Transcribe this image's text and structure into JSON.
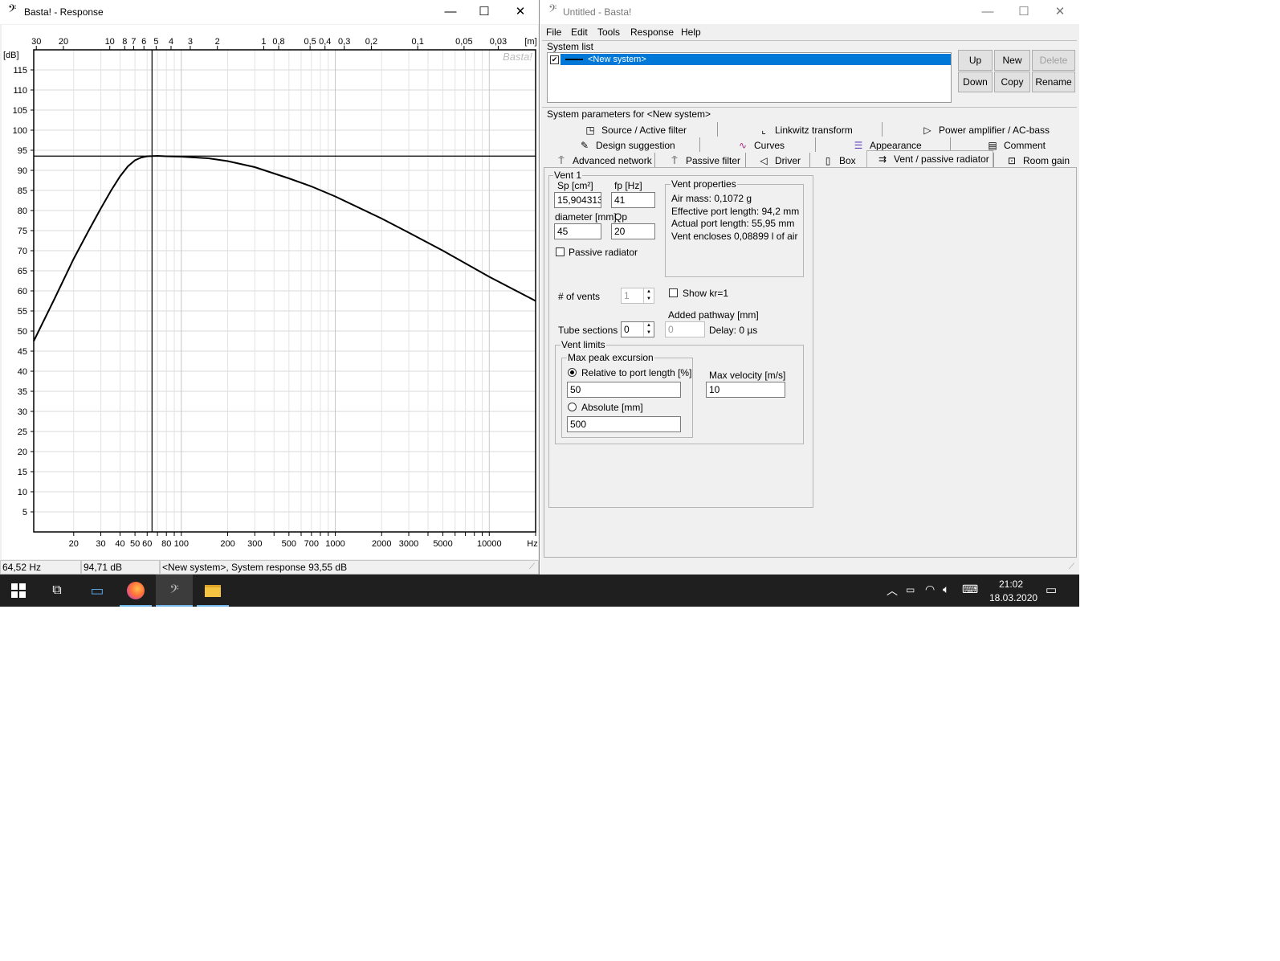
{
  "response_window": {
    "title": "Basta! - Response",
    "app_icon": "bass-clef-icon",
    "controls": {
      "minimize": "—",
      "maximize": "☐",
      "close": "✕"
    }
  },
  "chart_data": {
    "type": "line",
    "title": "",
    "xlabel": "Hz",
    "ylabel": "[dB]",
    "x_scale": "log",
    "xlim": [
      11,
      20000
    ],
    "ylim": [
      0,
      120
    ],
    "grid": true,
    "watermark": "Basta!",
    "x_tick_labels": [
      "20",
      "30",
      "40",
      "50",
      "60",
      "80",
      "100",
      "200",
      "300",
      "500",
      "700",
      "1000",
      "2000",
      "3000",
      "5000",
      "10000",
      "Hz"
    ],
    "x_ticks": [
      20,
      30,
      40,
      50,
      60,
      80,
      100,
      200,
      300,
      500,
      700,
      1000,
      2000,
      3000,
      5000,
      10000
    ],
    "y_ticks": [
      5,
      10,
      15,
      20,
      25,
      30,
      35,
      40,
      45,
      50,
      55,
      60,
      65,
      70,
      75,
      80,
      85,
      90,
      95,
      100,
      105,
      110,
      115
    ],
    "top_axis_label": "[m]",
    "top_ticks": [
      {
        "label": "30",
        "v": 30
      },
      {
        "label": "20",
        "v": 20
      },
      {
        "label": "10",
        "v": 10
      },
      {
        "label": "8",
        "v": 8
      },
      {
        "label": "7",
        "v": 7
      },
      {
        "label": "6",
        "v": 6
      },
      {
        "label": "5",
        "v": 5
      },
      {
        "label": "4",
        "v": 4
      },
      {
        "label": "3",
        "v": 3
      },
      {
        "label": "2",
        "v": 2
      },
      {
        "label": "1",
        "v": 1
      },
      {
        "label": "0,8",
        "v": 0.8
      },
      {
        "label": "0,5",
        "v": 0.5
      },
      {
        "label": "0,4",
        "v": 0.4
      },
      {
        "label": "0,3",
        "v": 0.3
      },
      {
        "label": "0,2",
        "v": 0.2
      },
      {
        "label": "0,1",
        "v": 0.1
      },
      {
        "label": "0,05",
        "v": 0.05
      },
      {
        "label": "0,03",
        "v": 0.03
      }
    ],
    "series": [
      {
        "color": "#000000",
        "x": [
          11,
          15,
          20,
          25,
          30,
          35,
          40,
          45,
          50,
          55,
          60,
          70,
          80,
          100,
          150,
          200,
          300,
          500,
          700,
          1000,
          2000,
          3000,
          5000,
          10000,
          20000
        ],
        "y": [
          47.5,
          58,
          68,
          75,
          80.5,
          85,
          88.5,
          91,
          92.5,
          93.2,
          93.5,
          93.6,
          93.5,
          93.4,
          93,
          92.3,
          90.8,
          88,
          86,
          83.5,
          78,
          74.5,
          70,
          63.5,
          57.5
        ]
      }
    ],
    "cursor": {
      "x": 64.52,
      "y": 93.55
    }
  },
  "status_bar": {
    "freq": "64,52 Hz",
    "level": "94,71 dB",
    "info": "<New system>, System response 93,55 dB"
  },
  "main_window": {
    "title": "Untitled - Basta!",
    "menu": [
      "File",
      "Edit",
      "Tools",
      "Response",
      "Help"
    ],
    "system_list": {
      "label": "System list",
      "item": "<New system>",
      "item_checked": true,
      "buttons": {
        "up": "Up",
        "new": "New",
        "delete": "Delete",
        "down": "Down",
        "copy": "Copy",
        "rename": "Rename"
      }
    },
    "params_label": "System parameters for <New system>",
    "tabs_row1": [
      {
        "label": "Source / Active filter",
        "icon": "source-filter-icon"
      },
      {
        "label": "Linkwitz transform",
        "icon": "linkwitz-icon"
      },
      {
        "label": "Power amplifier / AC-bass",
        "icon": "amplifier-icon"
      }
    ],
    "tabs_row2": [
      {
        "label": "Design suggestion",
        "icon": "pencil-icon"
      },
      {
        "label": "Curves",
        "icon": "curves-icon"
      },
      {
        "label": "Appearance",
        "icon": "appearance-icon"
      },
      {
        "label": "Comment",
        "icon": "comment-icon"
      }
    ],
    "tabs_row3": [
      {
        "label": "Advanced network",
        "icon": "network-icon"
      },
      {
        "label": "Passive filter",
        "icon": "passive-filter-icon"
      },
      {
        "label": "Driver",
        "icon": "speaker-icon"
      },
      {
        "label": "Box",
        "icon": "box-icon"
      },
      {
        "label": "Vent / passive radiator",
        "icon": "vent-icon"
      },
      {
        "label": "Room gain",
        "icon": "room-gain-icon"
      }
    ],
    "vent": {
      "group_label": "Vent 1",
      "sp_label": "Sp [cm²]",
      "sp_value": "15,904313",
      "fp_label": "fp [Hz]",
      "fp_value": "41",
      "diameter_label": "diameter [mm]",
      "diameter_value": "45",
      "qp_label": "Qp",
      "qp_value": "20",
      "passive_radiator_label": "Passive radiator",
      "props_label": "Vent properties",
      "air_mass": "Air mass: 0,1072 g",
      "eff_length": "Effective port length: 94,2 mm",
      "act_length": "Actual port length: 55,95 mm",
      "encloses": "Vent encloses 0,08899 l of air",
      "num_vents_label": "# of vents",
      "num_vents_value": "1",
      "show_kr_label": "Show kr=1",
      "added_pathway_label": "Added pathway [mm]",
      "added_pathway_value": "0",
      "delay": "Delay: 0 µs",
      "tube_sections_label": "Tube sections",
      "tube_sections_value": "0",
      "limits_label": "Vent limits",
      "max_peak_label": "Max peak excursion",
      "relative_label": "Relative to port length [%]",
      "relative_value": "50",
      "absolute_label": "Absolute [mm]",
      "absolute_value": "500",
      "max_velocity_label": "Max velocity [m/s]",
      "max_velocity_value": "10"
    }
  },
  "taskbar": {
    "time": "21:02",
    "date": "18.03.2020",
    "icons": [
      "windows-start-icon",
      "task-view-icon",
      "laptop-app-icon",
      "firefox-icon",
      "basta-icon",
      "file-explorer-icon"
    ]
  }
}
